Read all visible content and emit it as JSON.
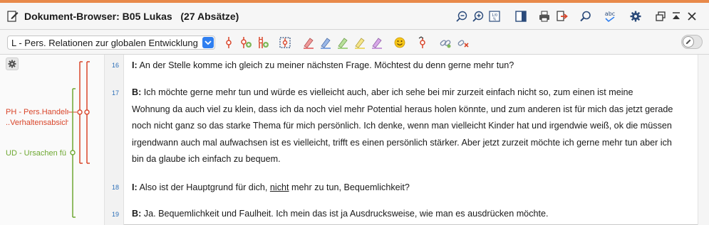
{
  "window": {
    "title": "Dokument-Browser: B05 Lukas   (27 Absätze)"
  },
  "colors": {
    "accent": "#e8894a",
    "code_ph": "#d9462b",
    "code_ud": "#6ea832",
    "line_numbers": "#2c6fb8"
  },
  "titlebar_icons": [
    "zoom-out-icon",
    "zoom-in-icon",
    "font-size-icon",
    "panel-icon",
    "print-icon",
    "export-icon",
    "search-icon",
    "spellcheck-icon",
    "settings-gear-icon",
    "restore-window-icon",
    "collapse-icon",
    "close-icon"
  ],
  "toolbar": {
    "code_select": "L - Pers. Relationen zur globalen Entwicklung",
    "icons": [
      "code-icon",
      "code-in-vivo-icon",
      "code-recent-icon",
      "code-select-icon",
      "highlight-red-icon",
      "highlight-blue-icon",
      "highlight-green-icon",
      "highlight-yellow-icon",
      "highlight-purple-icon",
      "emoticon-icon",
      "code-remove-icon",
      "link-icon",
      "unlink-icon",
      "edit-mode-toggle"
    ]
  },
  "codes": [
    {
      "label": "PH - Pers.Handelr",
      "color": "#d9462b"
    },
    {
      "label": "..Verhaltensabsich",
      "color": "#d9462b"
    },
    {
      "label": "UD - Ursachen fü",
      "color": "#6ea832"
    }
  ],
  "paragraphs": [
    {
      "number": "16",
      "speaker": "I:",
      "text": " An der Stelle komme ich gleich zu meiner nächsten Frage. Möchtest du denn gerne mehr tun?"
    },
    {
      "number": "17",
      "speaker": "B:",
      "lines": [
        " Ich möchte gerne mehr tun und würde es vielleicht auch, aber ich sehe bei mir zurzeit einfach nicht so, zum einen ist meine",
        "Wohnung da auch viel zu klein, dass ich da noch viel mehr Potential heraus holen könnte, und zum anderen ist für mich das jetzt gerade",
        "noch nicht ganz so das starke Thema für mich persönlich. Ich denke, wenn man vielleicht Kinder hat und irgendwie weiß, ok die müssen",
        "irgendwann auch mal aufwachsen ist es vielleicht, trifft es einen persönlich stärker. Aber jetzt zurzeit möchte ich gerne mehr tun aber ich",
        "bin da glaube ich einfach zu bequem."
      ]
    },
    {
      "number": "18",
      "speaker": "I:",
      "text_before": " Also ist der Hauptgrund für dich, ",
      "text_underlined": "nicht",
      "text_after": " mehr zu tun, Bequemlichkeit?"
    },
    {
      "number": "19",
      "speaker": "B:",
      "text": " Ja. Bequemlichkeit und Faulheit. Ich mein das ist ja Ausdrucksweise, wie man es ausdrücken möchte."
    }
  ]
}
